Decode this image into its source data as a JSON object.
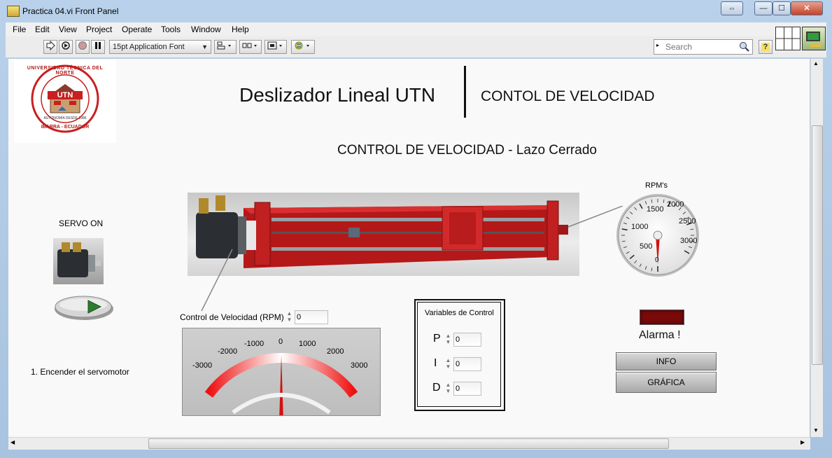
{
  "window": {
    "title": "Practica 04.vi Front Panel",
    "restore_label": "⇔",
    "minimize_label": "—",
    "maximize_label": "☐",
    "close_label": "✕"
  },
  "menu": [
    "File",
    "Edit",
    "View",
    "Project",
    "Operate",
    "Tools",
    "Window",
    "Help"
  ],
  "toolbar": {
    "font_value": "15pt Application Font",
    "search_placeholder": "Search",
    "help_label": "?"
  },
  "logo": {
    "ring_text": "UNIVERSIDAD TÉCNICA DEL NORTE",
    "center_text": "UTN",
    "bottom_text": "IBARRA - ECUADOR",
    "small_text": "AUTONOMÍA DESDE 1986"
  },
  "header": {
    "title": "Deslizador Lineal UTN",
    "subtitle": "CONTOL DE VELOCIDAD",
    "section": "CONTROL DE VELOCIDAD - Lazo Cerrado"
  },
  "servo": {
    "label": "SERVO ON",
    "instruction": "1. Encender el servomotor"
  },
  "rpm_gauge": {
    "label": "RPM's",
    "ticks": [
      "500",
      "1000",
      "1500",
      "2000",
      "2500",
      "3000"
    ],
    "zero_label": "0",
    "value": 0,
    "max": 3000
  },
  "velocity_control": {
    "label": "Control de Velocidad (RPM)",
    "value": "0",
    "meter_ticks": [
      "-3000",
      "-2000",
      "-1000",
      "0",
      "1000",
      "2000",
      "3000"
    ],
    "meter_value": 0
  },
  "pid": {
    "title": "Variables de Control",
    "p_label": "P",
    "p_value": "0",
    "i_label": "I",
    "i_value": "0",
    "d_label": "D",
    "d_value": "0"
  },
  "alarm": {
    "label": "Alarma !",
    "led_color": "#7a0a0a"
  },
  "buttons": {
    "info": "INFO",
    "grafica": "GRÁFICA"
  },
  "colors": {
    "accent_red": "#cc1a1a",
    "panel_bg": "#f9f9f9"
  }
}
